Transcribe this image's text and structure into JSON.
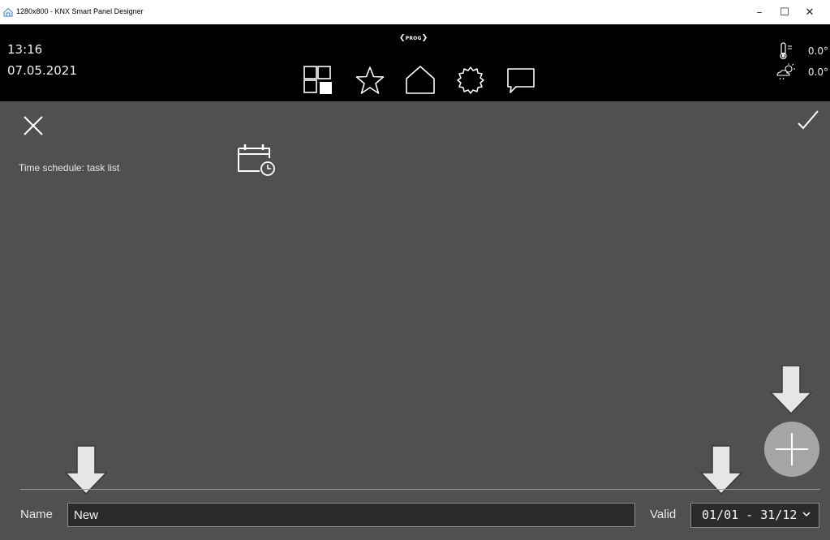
{
  "window": {
    "title": "1280x800 - KNX Smart Panel Designer",
    "controls": {
      "minimize": "–",
      "maximize": "☐",
      "close": "✕"
    }
  },
  "header": {
    "time": "13:16",
    "date": "07.05.2021",
    "prog_badge": "PROG",
    "nav_icons": [
      "rooms-grid-icon",
      "favorites-star-icon",
      "home-icon",
      "settings-gear-icon",
      "messages-icon"
    ],
    "temperature_value": "0.0°",
    "weather_value": "0.0°"
  },
  "page": {
    "section_label": "Time schedule: task list",
    "section_icon": "calendar-clock-icon"
  },
  "form": {
    "name_label": "Name",
    "name_value": "New",
    "valid_label": "Valid",
    "valid_value": "01/01 - 31/12"
  },
  "colors": {
    "background": "#505050",
    "header": "#000000",
    "input_bg": "#2b2b2b",
    "add_button": "#a6a6a6"
  }
}
